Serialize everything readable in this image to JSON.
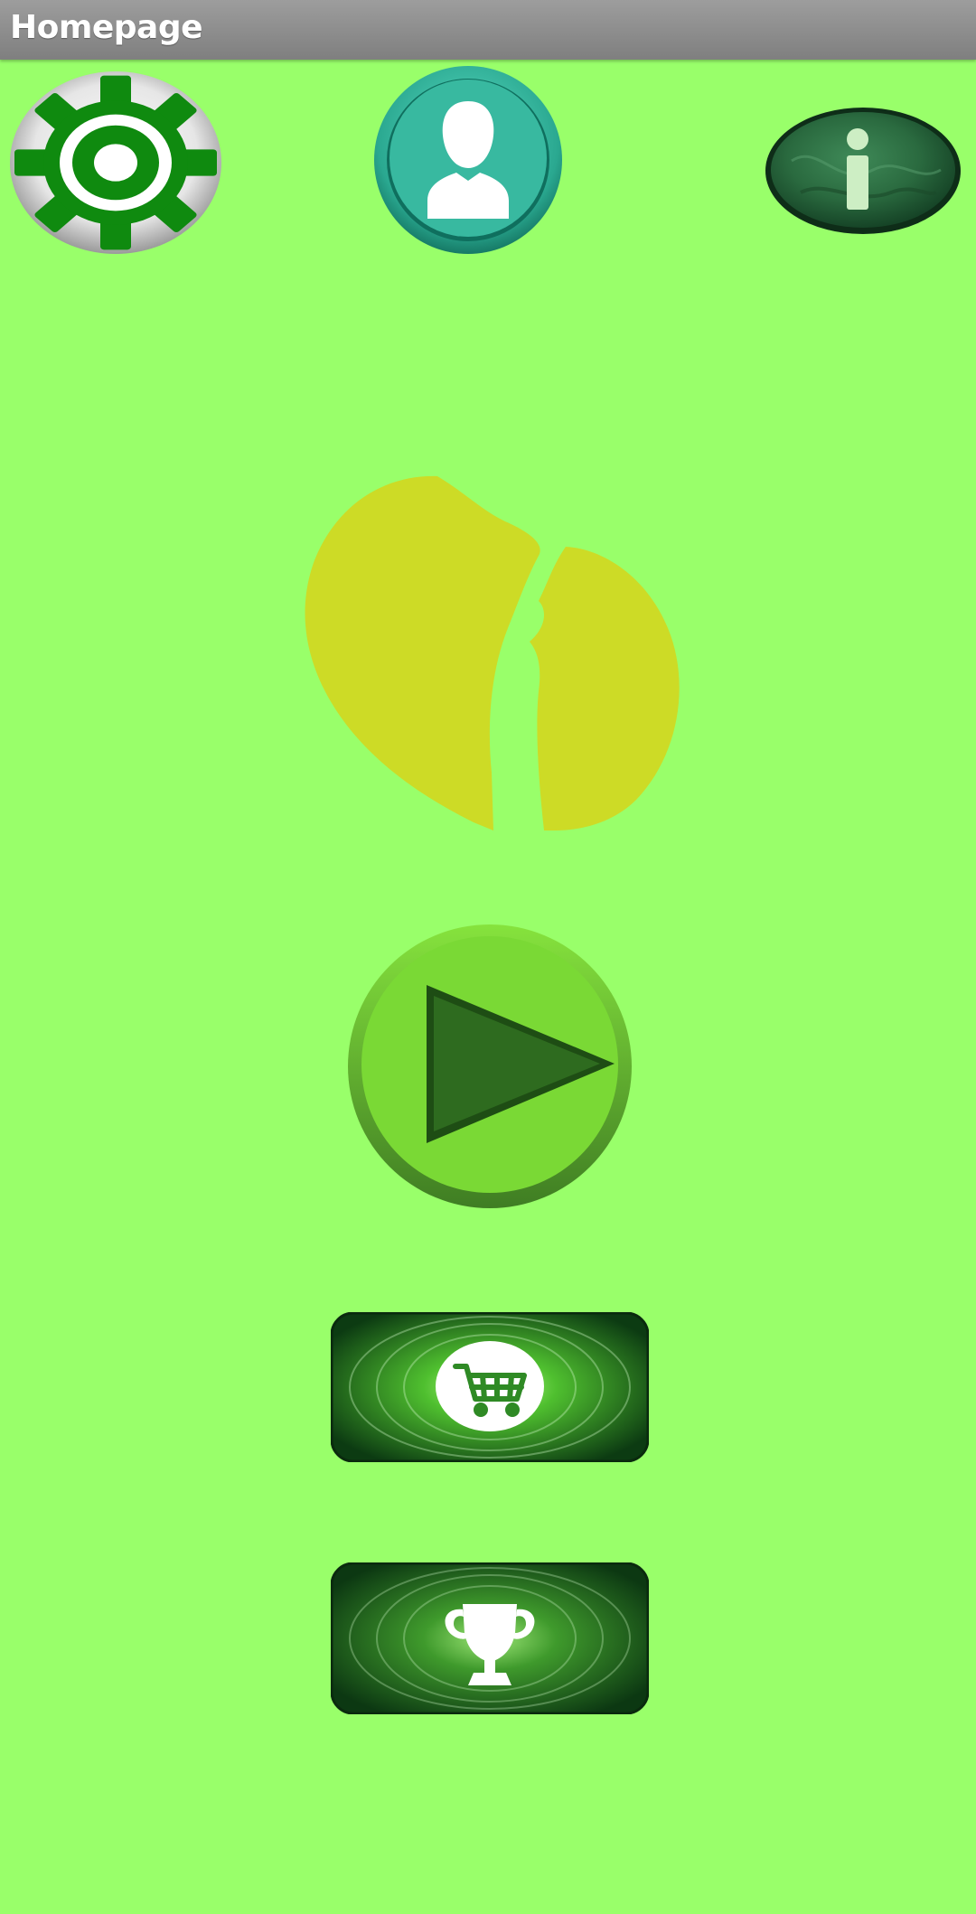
{
  "app": {
    "title": "Homepage"
  },
  "colors": {
    "background": "#99ff6a",
    "title_bar": "#8f8f8f",
    "title_text": "#ffffff",
    "logo": "#cddb26",
    "play_button": "#7ad935",
    "play_triangle": "#2e6b1f",
    "profile_button": "#38b9a0",
    "settings_gear": "#0f8a0f",
    "info_button": "#2f6e43"
  },
  "icons": {
    "settings": "gear-icon",
    "profile": "user-silhouette-icon",
    "info": "info-icon",
    "logo": "app-logo",
    "play": "play-icon",
    "shop": "shopping-cart-icon",
    "leaderboard": "trophy-icon"
  }
}
